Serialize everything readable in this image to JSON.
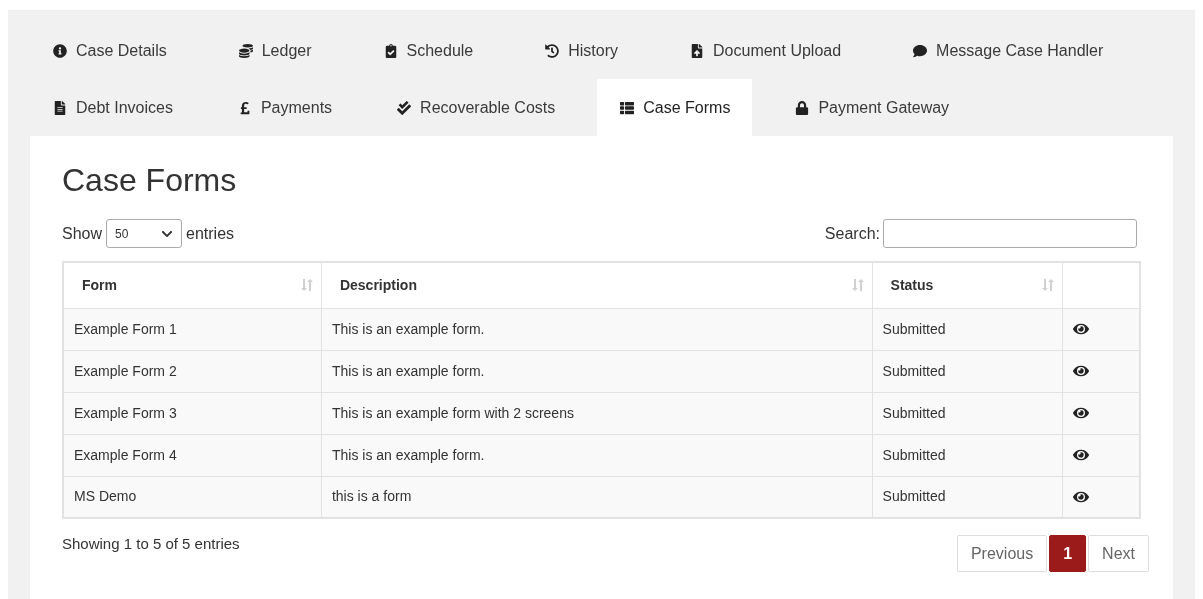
{
  "tab_rows": [
    {
      "tabs": [
        {
          "label": "Case Details",
          "selected": false
        },
        {
          "label": "Ledger",
          "selected": false
        },
        {
          "label": "Schedule",
          "selected": false
        },
        {
          "label": "History",
          "selected": false
        },
        {
          "label": "Document Upload",
          "selected": false
        },
        {
          "label": "Message Case Handler",
          "selected": false
        }
      ]
    },
    {
      "tabs": [
        {
          "label": "Debt Invoices",
          "selected": false
        },
        {
          "label": "Payments",
          "selected": false
        },
        {
          "label": "Recoverable Costs",
          "selected": false
        },
        {
          "label": "Case Forms",
          "selected": true
        },
        {
          "label": "Payment Gateway",
          "selected": false
        }
      ]
    }
  ],
  "heading": "Case Forms",
  "length_control": {
    "before": "Show",
    "value": "50",
    "after": "entries"
  },
  "search": {
    "label": "Search:"
  },
  "table": {
    "columns": [
      {
        "label": "Form",
        "sortable": true
      },
      {
        "label": "Description",
        "sortable": true
      },
      {
        "label": "Status",
        "sortable": true
      },
      {
        "sortable": false
      }
    ],
    "rows": [
      {
        "form": "Example Form 1",
        "description": "This is an example form.",
        "status": "Submitted"
      },
      {
        "form": "Example Form 2",
        "description": "This is an example form.",
        "status": "Submitted"
      },
      {
        "form": "Example Form 3",
        "description": "This is an example form with 2 screens",
        "status": "Submitted"
      },
      {
        "form": "Example Form 4",
        "description": "This is an example form.",
        "status": "Submitted"
      },
      {
        "form": "MS Demo",
        "description": "this is a form",
        "status": "Submitted"
      }
    ]
  },
  "info": "Showing 1 to 5 of 5 entries",
  "pagination": [
    {
      "label": "Previous",
      "selected": false
    },
    {
      "label": "1",
      "selected": true
    },
    {
      "label": "Next",
      "selected": false
    }
  ]
}
